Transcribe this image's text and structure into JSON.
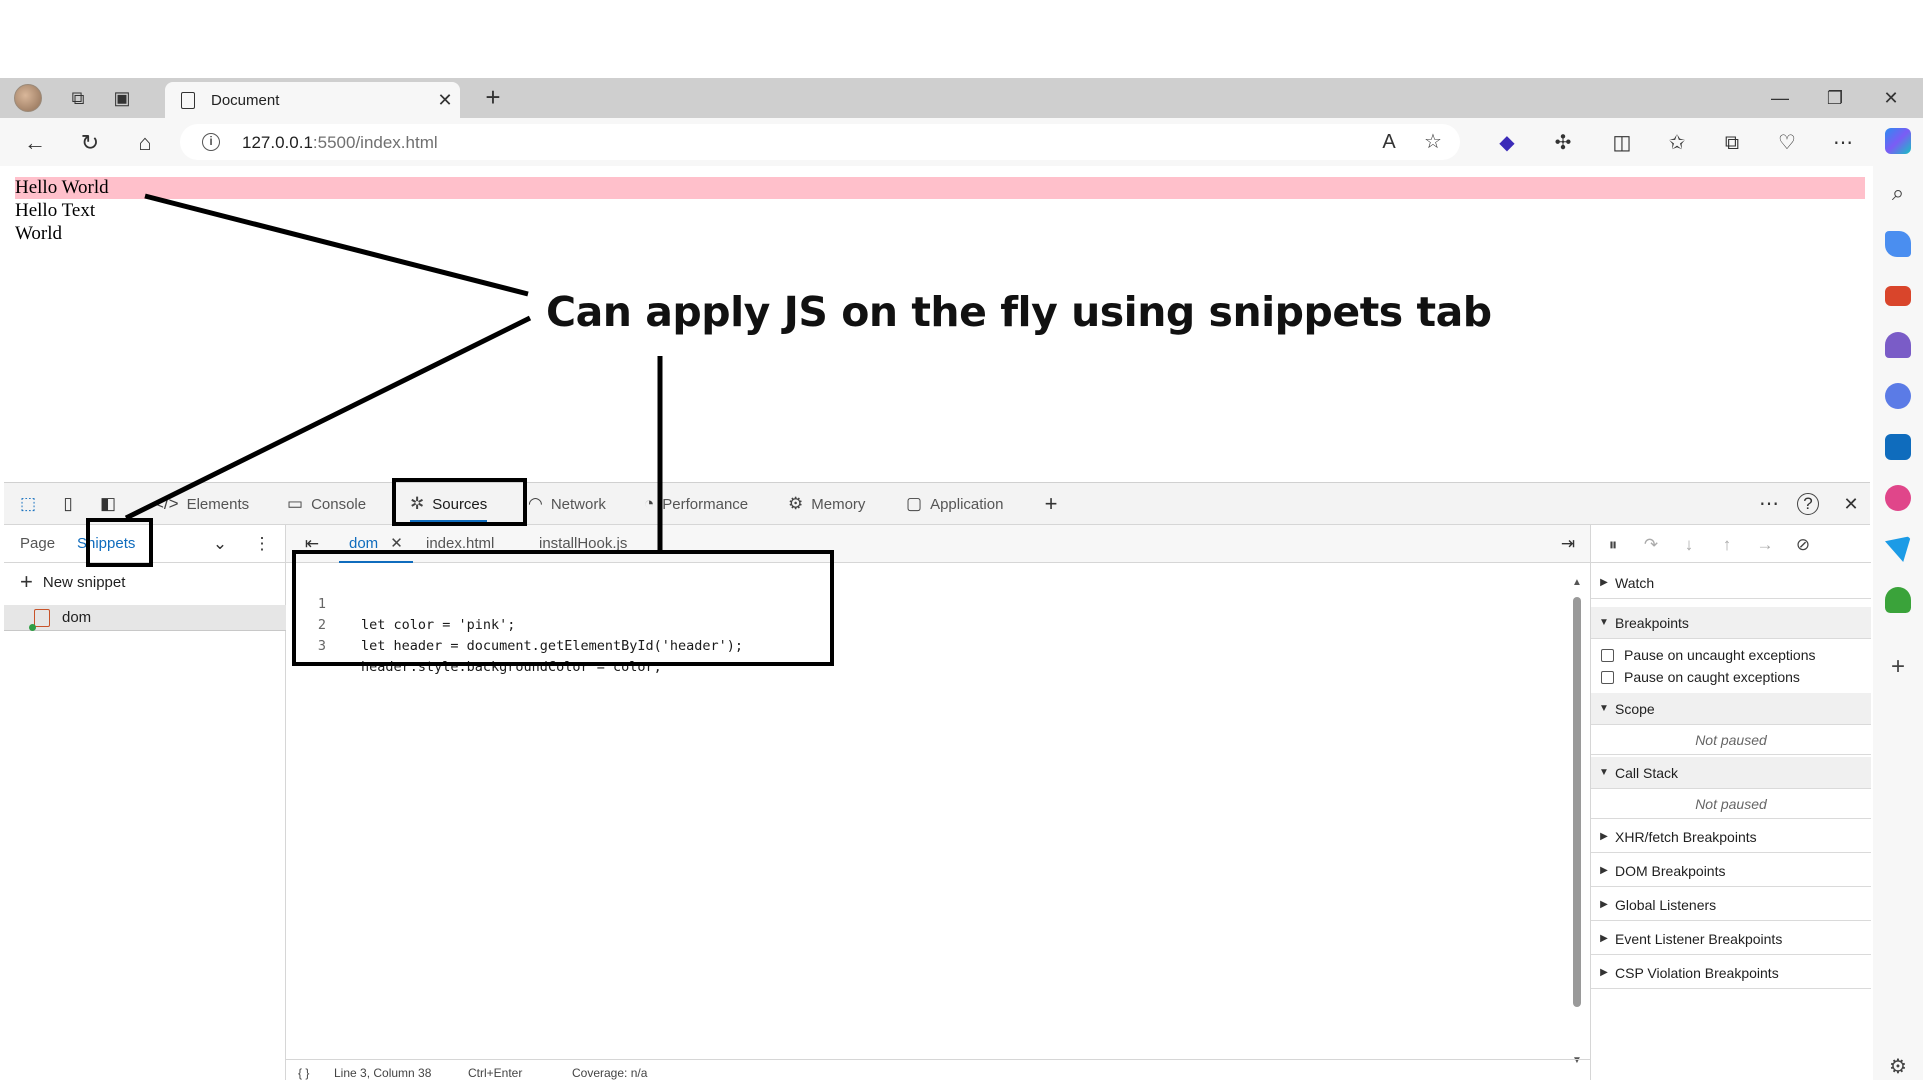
{
  "browser": {
    "tab_title": "Document",
    "close_glyph": "✕",
    "new_tab_glyph": "+",
    "url_host": "127.0.0.1",
    "url_path": ":5500/index.html",
    "window_controls": {
      "minimize": "—",
      "restore": "❐",
      "close": "✕"
    }
  },
  "page": {
    "lines": [
      "Hello World",
      "Hello Text",
      "World"
    ],
    "highlight_color": "#ffc0cb"
  },
  "devtools": {
    "tabs": [
      {
        "label": "Elements",
        "icon": "</>"
      },
      {
        "label": "Console",
        "icon": "▭"
      },
      {
        "label": "Sources",
        "icon": "✲"
      },
      {
        "label": "Network",
        "icon": "◠"
      },
      {
        "label": "Performance",
        "icon": "◔"
      },
      {
        "label": "Memory",
        "icon": "⚙"
      },
      {
        "label": "Application",
        "icon": "▢"
      }
    ],
    "add_tab_glyph": "+",
    "navigator": {
      "tabs": [
        "Page",
        "Snippets"
      ],
      "new_snippet_label": "New snippet",
      "snippets": [
        "dom"
      ]
    },
    "editor": {
      "tabs": [
        "dom",
        "index.html",
        "installHook.js"
      ],
      "code_lines": [
        {
          "number": "1",
          "text": "let color = 'pink';"
        },
        {
          "number": "2",
          "text": "let header = document.getElementById('header');"
        },
        {
          "number": "3",
          "text": "header.style.backgroundColor = color;"
        }
      ],
      "status": {
        "braces": "{ }",
        "position": "Line 3, Column 38",
        "run_hint": "Ctrl+Enter",
        "coverage": "Coverage: n/a"
      }
    },
    "debugger": {
      "watch": "Watch",
      "breakpoints": "Breakpoints",
      "pause_uncaught": "Pause on uncaught exceptions",
      "pause_caught": "Pause on caught exceptions",
      "scope": "Scope",
      "scope_status": "Not paused",
      "call_stack": "Call Stack",
      "call_stack_status": "Not paused",
      "xhr": "XHR/fetch Breakpoints",
      "dom": "DOM Breakpoints",
      "global": "Global Listeners",
      "event": "Event Listener Breakpoints",
      "csp": "CSP Violation Breakpoints"
    }
  },
  "annotation": {
    "text": "Can apply JS on the fly using snippets tab"
  },
  "colors": {
    "accent": "#0f6cbd",
    "pink": "#ffc0cb"
  }
}
